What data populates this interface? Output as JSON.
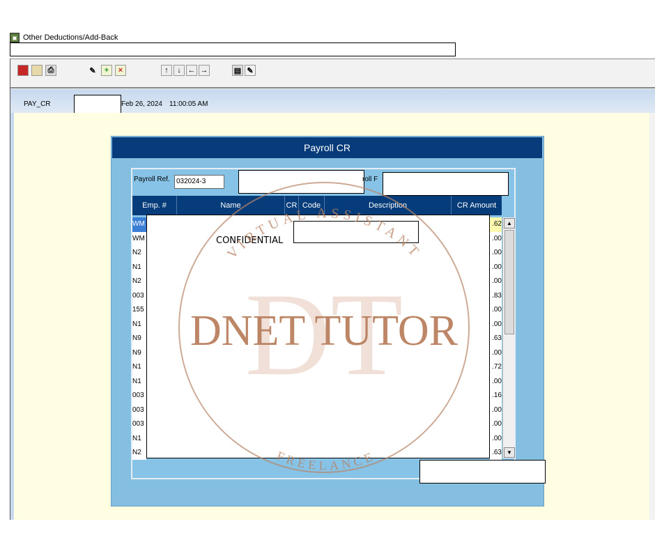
{
  "window": {
    "title": "Other Deductions/Add-Back"
  },
  "header": {
    "screen_code": "PAY_CR",
    "date": "Feb 26, 2024",
    "time": "11:00:05 AM"
  },
  "form": {
    "title": "Payroll CR",
    "payroll_ref_label": "Payroll Ref.",
    "payroll_ref_value": "032024-3",
    "payroll_partial_label": "roll F"
  },
  "grid": {
    "columns": [
      "Emp. #",
      "Name",
      "CR",
      "Code",
      "Description",
      "CR Amount"
    ],
    "emp_prefixes": [
      "WM",
      "WM",
      "N2",
      "N1",
      "N2",
      "003",
      "155",
      "N1",
      "N9",
      "N9",
      "N1",
      "N1",
      "003",
      "003",
      "003",
      "N1",
      "N2"
    ],
    "amount_suffixes": [
      ".62",
      ".00",
      ".00",
      ".00",
      ".00",
      ".83",
      ".00",
      ".00",
      ".63",
      ".00",
      ".72",
      ".00",
      ".16",
      ".00",
      ".00",
      ".00",
      ".63"
    ]
  },
  "overlay": {
    "confidential_label": "CONFIDENTIAL"
  },
  "watermark": {
    "brand": "DNET TUTOR",
    "monogram": "DT",
    "top_arc": "VIRTUAL ASSISTANT",
    "bottom_arc": "FREELANCE"
  },
  "toolbar": {
    "icons": [
      "exit-icon",
      "save-icon",
      "print-icon",
      "edit-icon",
      "add-icon",
      "delete-icon",
      "move-first-icon",
      "move-down-icon",
      "move-left-icon",
      "move-right-icon",
      "clipboard-icon",
      "note-edit-icon"
    ],
    "glyph_up": "↑",
    "glyph_down": "↓",
    "glyph_left": "←",
    "glyph_right": "→"
  }
}
